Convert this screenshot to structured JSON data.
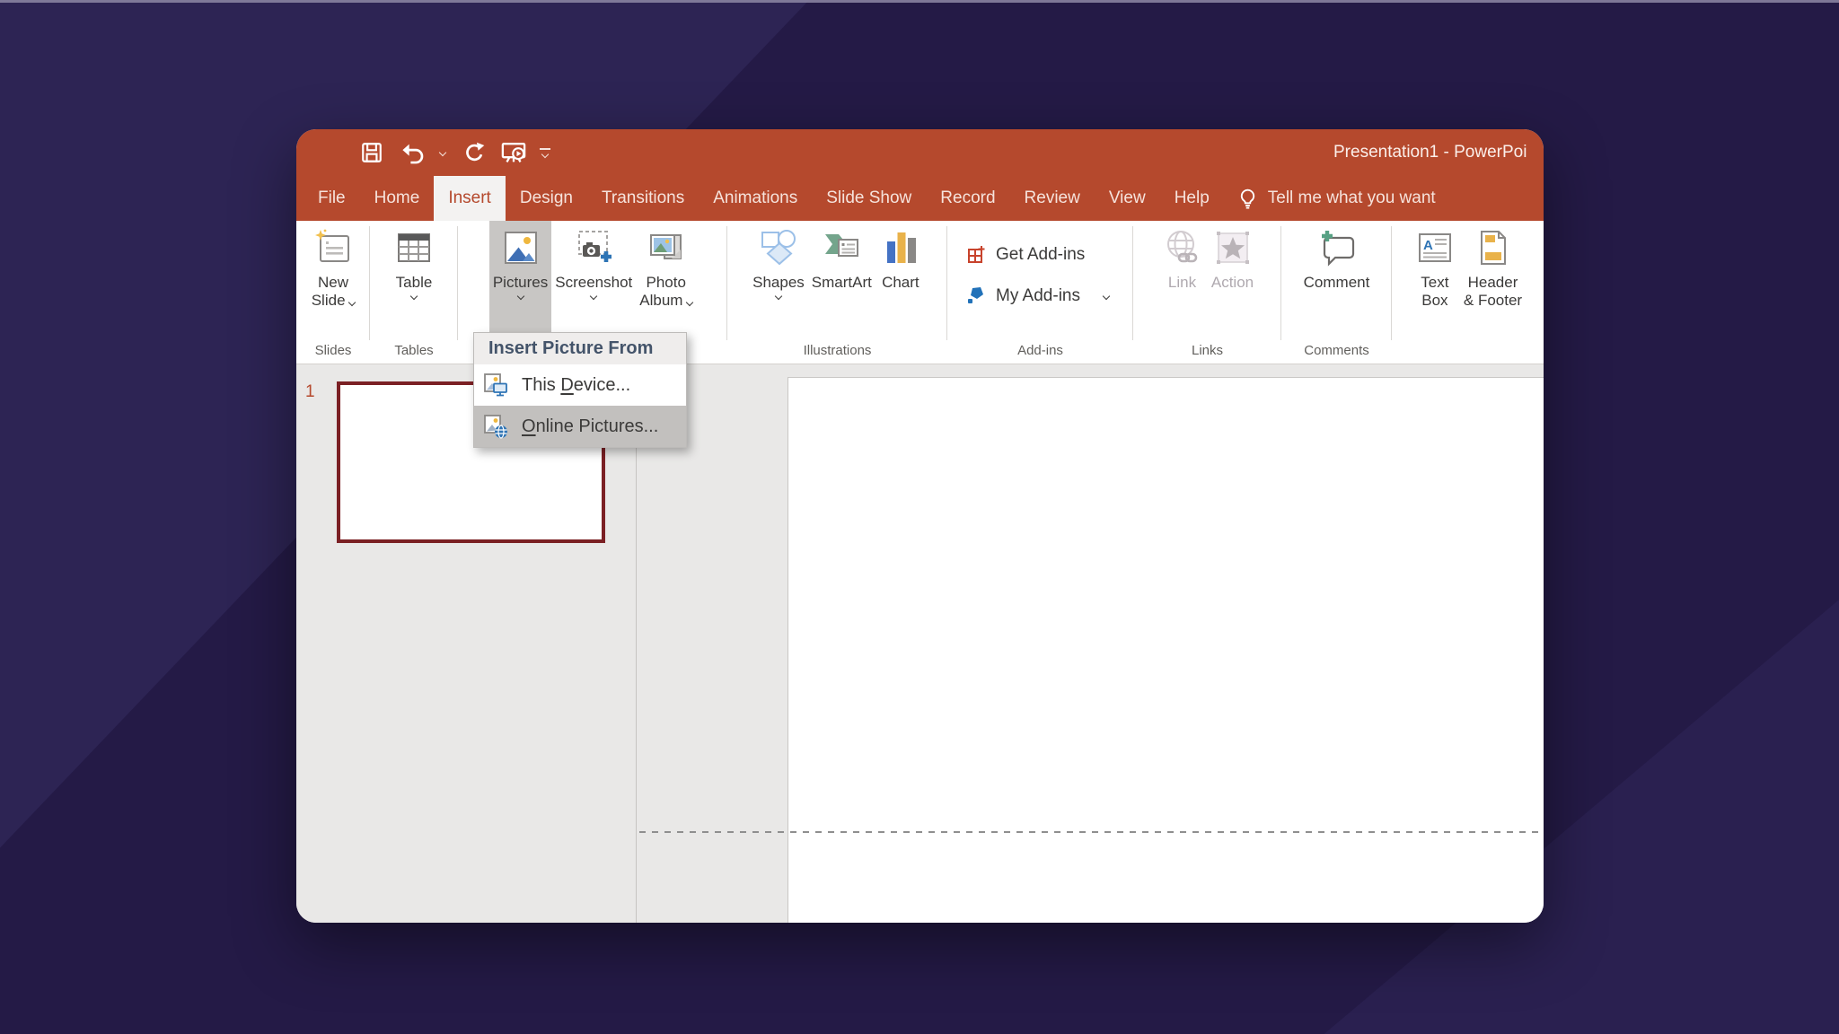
{
  "colors": {
    "brand_red": "#B5492D",
    "background_purple": "#241A46",
    "background_purple_light": "#2D2454",
    "menu_highlight": "#C2C0BE",
    "selected_thumb_border": "#7B2024",
    "disabled_text": "#AFA9AF"
  },
  "titlebar": {
    "title": "Presentation1 - PowerPoi"
  },
  "tabs": {
    "items": [
      "File",
      "Home",
      "Insert",
      "Design",
      "Transitions",
      "Animations",
      "Slide Show",
      "Record",
      "Review",
      "View",
      "Help"
    ],
    "active": "Insert",
    "tell_me": "Tell me what you want"
  },
  "ribbon": {
    "groups": [
      {
        "label": "Slides"
      },
      {
        "label": "Tables"
      },
      {
        "label": ""
      },
      {
        "label": "Illustrations"
      },
      {
        "label": "Add-ins"
      },
      {
        "label": "Links"
      },
      {
        "label": "Comments"
      },
      {
        "label": ""
      }
    ],
    "buttons": {
      "new_slide_1": "New",
      "new_slide_2": "Slide",
      "table": "Table",
      "pictures": "Pictures",
      "screenshot": "Screenshot",
      "photo_album_1": "Photo",
      "photo_album_2": "Album",
      "shapes": "Shapes",
      "smartart": "SmartArt",
      "chart": "Chart",
      "get_addins": "Get Add-ins",
      "my_addins": "My Add-ins",
      "link": "Link",
      "action": "Action",
      "comment": "Comment",
      "text_box_1": "Text",
      "text_box_2": "Box",
      "header_footer_1": "Header",
      "header_footer_2": "& Footer"
    }
  },
  "pictures_menu": {
    "header": "Insert Picture From",
    "items": [
      {
        "pre": "This ",
        "key": "D",
        "post": "evice..."
      },
      {
        "pre": "",
        "key": "O",
        "post": "nline Pictures..."
      }
    ]
  },
  "slide_panel": {
    "slide_number": "1"
  }
}
